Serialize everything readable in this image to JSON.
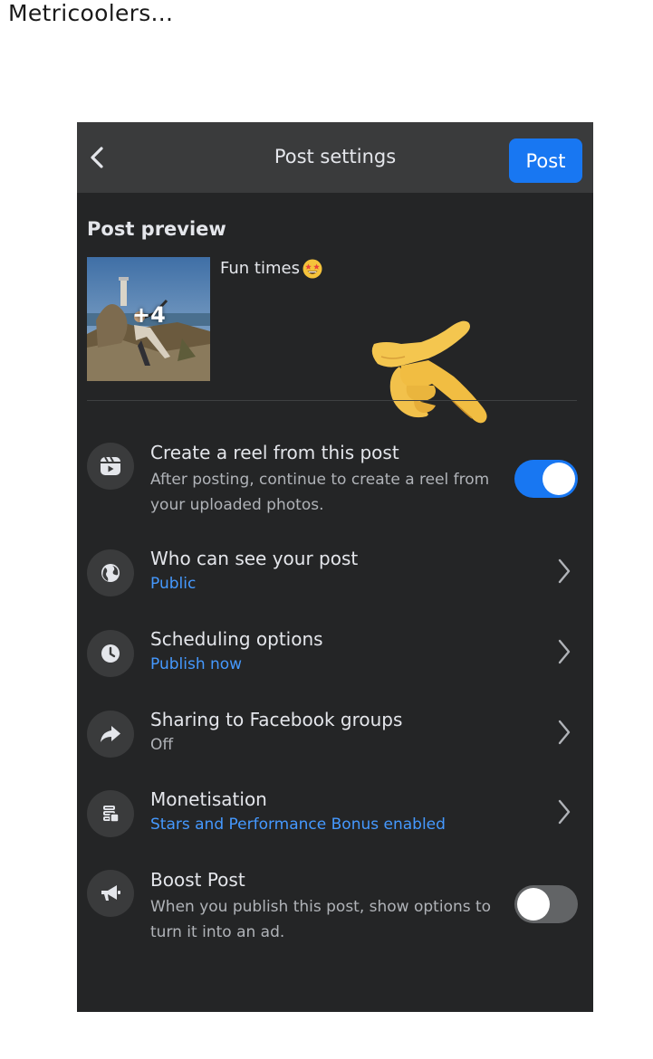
{
  "caption": "Metricoolers...",
  "header": {
    "title": "Post settings",
    "post_button": "Post"
  },
  "preview": {
    "heading": "Post preview",
    "photo_count": "+4",
    "caption_text": "Fun times"
  },
  "settings": [
    {
      "title": "Create a reel from this post",
      "description": "After posting, continue to create a reel from your uploaded photos.",
      "icon": "reel-icon",
      "control": "toggle",
      "toggle_on": true
    },
    {
      "title": "Who can see your post",
      "value": "Public",
      "icon": "globe-icon",
      "control": "chevron"
    },
    {
      "title": "Scheduling options",
      "value": "Publish now",
      "icon": "clock-icon",
      "control": "chevron"
    },
    {
      "title": "Sharing to Facebook groups",
      "value": "Off",
      "icon": "share-icon",
      "control": "chevron"
    },
    {
      "title": "Monetisation",
      "value": "Stars and Performance Bonus enabled",
      "icon": "coins-icon",
      "control": "chevron"
    },
    {
      "title": "Boost Post",
      "description": "When you publish this post, show options to turn it into an ad.",
      "icon": "megaphone-icon",
      "control": "toggle",
      "toggle_on": false
    }
  ],
  "colors": {
    "background": "#242526",
    "header": "#3a3b3c",
    "accent": "#1877f2",
    "link": "#4599ff"
  }
}
